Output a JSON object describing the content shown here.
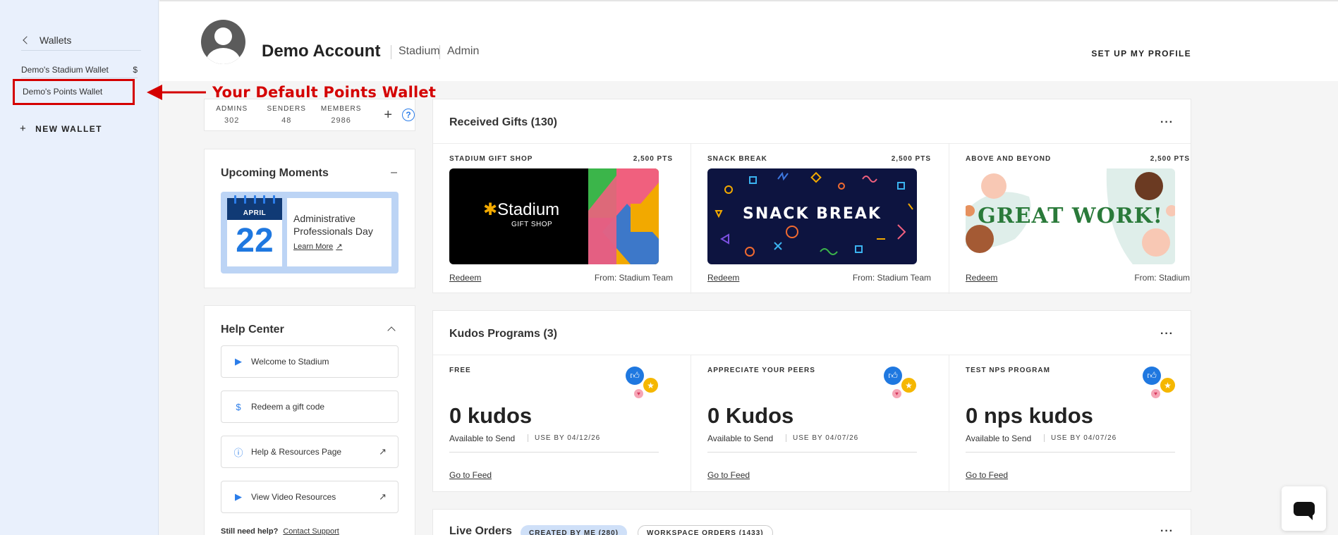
{
  "sidebar": {
    "back_label": "Wallets",
    "wallets": [
      {
        "label": "Demo's Stadium Wallet",
        "symbol": "$"
      },
      {
        "label": "Demo's Points Wallet",
        "symbol": ""
      }
    ],
    "new_wallet_label": "NEW WALLET"
  },
  "annotation": {
    "text": "Your Default Points Wallet",
    "color": "#d40000"
  },
  "header": {
    "account_name": "Demo Account",
    "tags": [
      "Stadium",
      "Admin"
    ],
    "setup_label": "SET UP MY PROFILE"
  },
  "stats": [
    {
      "label": "ADMINS",
      "value": "302"
    },
    {
      "label": "SENDERS",
      "value": "48"
    },
    {
      "label": "MEMBERS",
      "value": "2986"
    }
  ],
  "moments": {
    "title": "Upcoming Moments",
    "collapse_icon": "minus-icon",
    "month": "APRIL",
    "day": "22",
    "event": "Administrative Professionals Day",
    "link": "Learn More"
  },
  "help": {
    "title": "Help Center",
    "items": [
      {
        "label": "Welcome to Stadium",
        "icon": "video-icon",
        "external": false
      },
      {
        "label": "Redeem a gift code",
        "icon": "dollar-icon",
        "external": false
      },
      {
        "label": "Help & Resources Page",
        "icon": "info-icon",
        "external": true
      },
      {
        "label": "View Video Resources",
        "icon": "video-icon",
        "external": true
      }
    ],
    "footer_q": "Still need help?",
    "footer_link": "Contact Support"
  },
  "gifts": {
    "title": "Received Gifts (130)",
    "items": [
      {
        "name": "STADIUM GIFT SHOP",
        "points": "2,500 PTS",
        "image_text": "Stadium",
        "image_sub": "GIFT SHOP",
        "redeem": "Redeem",
        "from": "From: Stadium Team"
      },
      {
        "name": "SNACK BREAK",
        "points": "2,500 PTS",
        "image_text": "SNACK BREAK",
        "redeem": "Redeem",
        "from": "From: Stadium Team"
      },
      {
        "name": "ABOVE AND BEYOND",
        "points": "2,500 PTS",
        "image_text": "GREAT WORK!",
        "redeem": "Redeem",
        "from": "From: Stadium"
      }
    ]
  },
  "kudos": {
    "title": "Kudos Programs (3)",
    "items": [
      {
        "name": "FREE",
        "amount": "0 kudos",
        "available": "Available to Send",
        "use_by": "USE BY 04/12/26",
        "feed": "Go to Feed"
      },
      {
        "name": "APPRECIATE YOUR PEERS",
        "amount": "0 Kudos",
        "available": "Available to Send",
        "use_by": "USE BY 04/07/26",
        "feed": "Go to Feed"
      },
      {
        "name": "TEST NPS PROGRAM",
        "amount": "0 nps kudos",
        "available": "Available to Send",
        "use_by": "USE BY 04/07/26",
        "feed": "Go to Feed"
      }
    ]
  },
  "orders": {
    "title": "Live Orders",
    "pill_created": "CREATED BY ME (280)",
    "pill_workspace": "WORKSPACE ORDERS (1433)"
  },
  "colors": {
    "accent": "#1f78e0",
    "sidebar_bg": "#e9f0fc",
    "highlight": "#d40000"
  }
}
